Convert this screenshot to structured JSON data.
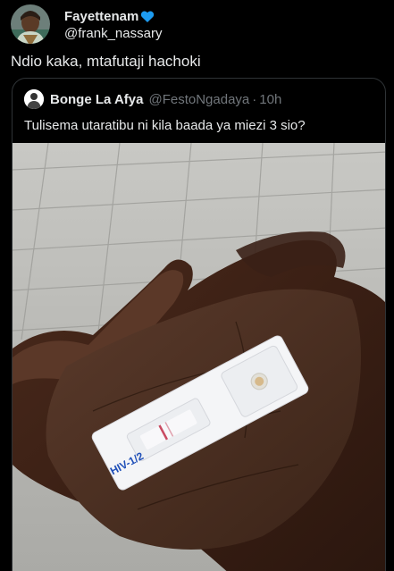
{
  "post": {
    "author": {
      "display_name": "Fayettenam",
      "handle": "@frank_nassary",
      "badge_icon": "blue-heart-icon"
    },
    "text": "Ndio kaka, mtafutaji hachoki"
  },
  "quote": {
    "author": {
      "display_name": "Bonge La Afya",
      "handle": "@FestoNgadaya",
      "separator": "·",
      "time": "10h"
    },
    "text": "Tulisema utaratibu ni kila baada ya miezi 3 sio?",
    "media": {
      "test_label": "HIV-1/2"
    }
  },
  "colors": {
    "background": "#000000",
    "text": "#e7e9ea",
    "muted": "#71767b",
    "border": "#2f3336",
    "heart": "#1d9bf0"
  }
}
